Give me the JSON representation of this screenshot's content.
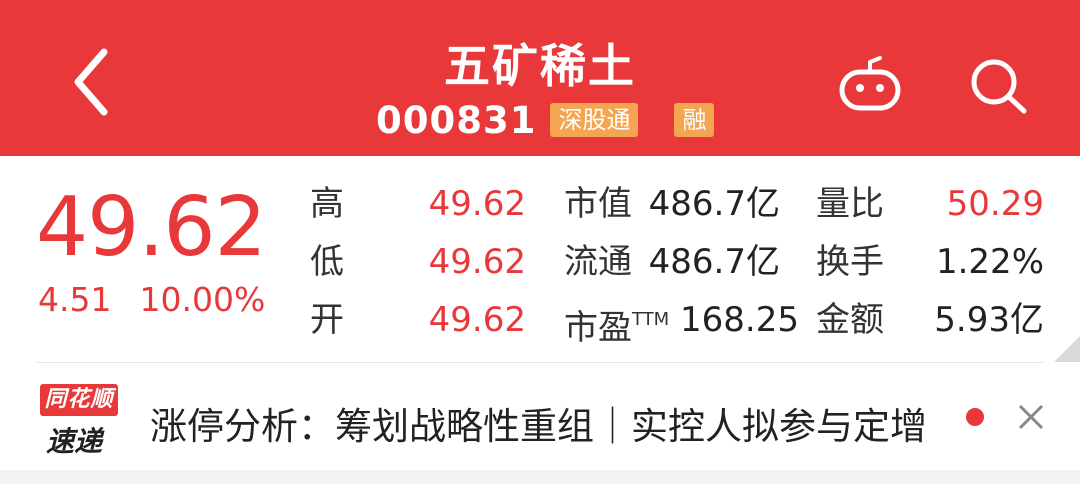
{
  "header": {
    "title": "五矿稀土",
    "code": "000831",
    "tags": [
      "深股通",
      "融"
    ],
    "icons": [
      "back-icon",
      "robot-icon",
      "search-icon"
    ]
  },
  "quote": {
    "price": "49.62",
    "change": "4.51",
    "change_pct": "10.00%",
    "rows": [
      {
        "label": "高",
        "value": "49.62",
        "label2": "市值",
        "value2": "486.7亿",
        "label3": "量比",
        "value3": "50.29"
      },
      {
        "label": "低",
        "value": "49.62",
        "label2": "流通",
        "value2": "486.7亿",
        "label3": "换手",
        "value3": "1.22%"
      },
      {
        "label": "开",
        "value": "49.62",
        "label2": "市盈",
        "label2_sup": "TTM",
        "value2": "168.25",
        "label3": "金额",
        "value3": "5.93亿"
      }
    ]
  },
  "news": {
    "logo_top": "同花顺",
    "logo_bottom": "速递",
    "text": "涨停分析：筹划战略性重组｜实控人拟参与定增"
  },
  "colors": {
    "accent": "#e8383a",
    "tag": "#f4a552"
  }
}
